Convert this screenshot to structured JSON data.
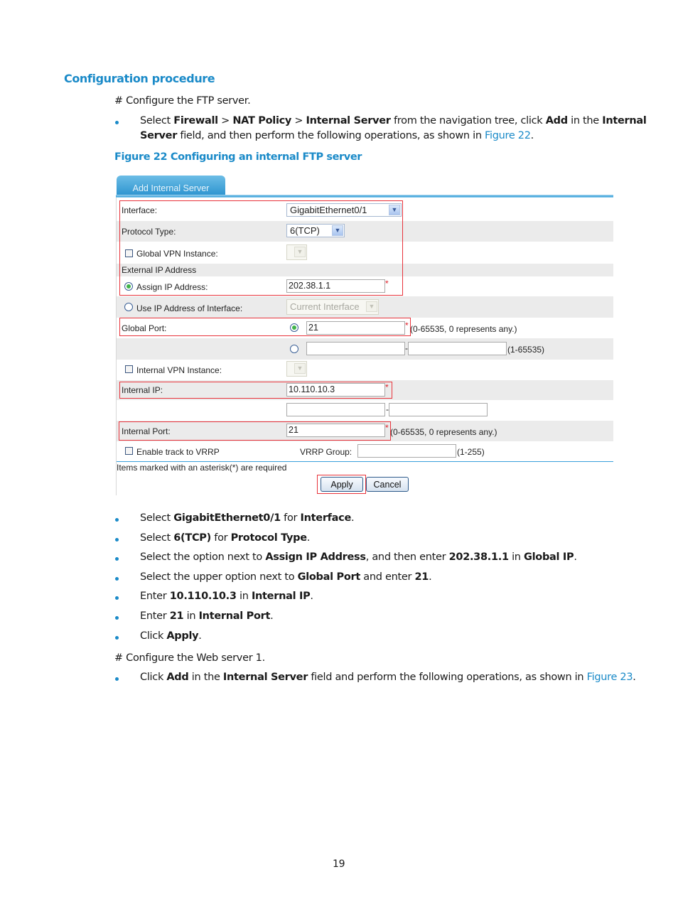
{
  "section": {
    "heading": "Configuration procedure",
    "intro_ftp": "# Configure the FTP server.",
    "step1": {
      "parts": [
        "Select ",
        "Firewall",
        " > ",
        "NAT Policy",
        " > ",
        "Internal Server",
        " from the navigation tree, click ",
        "Add",
        " in the ",
        "Internal"
      ],
      "line2": [
        "Server",
        " field, and then perform the following operations, as shown in ",
        "Figure 22",
        "."
      ]
    },
    "figure_caption": "Figure 22 Configuring an internal FTP server"
  },
  "form": {
    "tab_label": "Add Internal Server",
    "interface_label": "Interface:",
    "interface_value": "GigabitEthernet0/1",
    "protocol_label": "Protocol Type:",
    "protocol_value": "6(TCP)",
    "global_vpn_label": "Global VPN Instance:",
    "global_vpn_checked": false,
    "external_ip_header": "External IP Address",
    "assign_ip_label": "Assign IP Address:",
    "assign_ip_selected": true,
    "assign_ip_value": "202.38.1.1",
    "use_iface_label": "Use IP Address of Interface:",
    "use_iface_value": "Current Interface",
    "global_port_label": "Global Port:",
    "global_port_value": "21",
    "global_port_hint": "(0-65535, 0 represents any.)",
    "global_port_range_hint": "(1-65535)",
    "range_dash": "-",
    "internal_vpn_label": "Internal VPN Instance:",
    "internal_ip_label": "Internal IP:",
    "internal_ip_value": "10.110.10.3",
    "internal_port_label": "Internal Port:",
    "internal_port_value": "21",
    "internal_port_hint": "(0-65535, 0 represents any.)",
    "vrrp_track_label": "Enable track to VRRP",
    "vrrp_group_label": "VRRP Group:",
    "vrrp_group_hint": "(1-255)",
    "required_note": "Items marked with an asterisk(*) are required",
    "asterisk": "*",
    "apply_label": "Apply",
    "cancel_label": "Cancel"
  },
  "steps": [
    [
      "Select ",
      "GigabitEthernet0/1",
      " for ",
      "Interface",
      "."
    ],
    [
      "Select ",
      "6(TCP)",
      " for ",
      "Protocol Type",
      "."
    ],
    [
      "Select the option next to ",
      "Assign IP Address",
      ", and then enter ",
      "202.38.1.1",
      " in ",
      "Global IP",
      "."
    ],
    [
      "Select the upper option next to ",
      "Global Port",
      " and enter ",
      "21",
      "."
    ],
    [
      "Enter ",
      "10.110.10.3",
      " in ",
      "Internal IP",
      "."
    ],
    [
      "Enter ",
      "21",
      " in ",
      "Internal Port",
      "."
    ],
    [
      "Click ",
      "Apply",
      "."
    ]
  ],
  "web_intro": "# Configure the Web server 1.",
  "web_step": [
    "Click ",
    "Add",
    " in the ",
    "Internal Server",
    " field and perform the following operations, as shown in ",
    "Figure 23",
    "."
  ],
  "page_number": "19"
}
